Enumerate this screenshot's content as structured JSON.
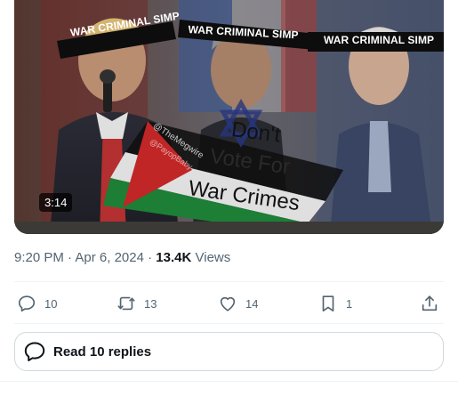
{
  "video": {
    "duration": "3:14",
    "banners": [
      "WAR CRIMINAL SIMP",
      "WAR CRIMINAL SIMP",
      "WAR CRIMINAL SIMP"
    ],
    "slogan": [
      "Don't",
      "Vote For",
      "War Crimes"
    ],
    "watermarks": [
      "@TheMegwire",
      "@PayopBaby"
    ]
  },
  "meta": {
    "time": "9:20 PM",
    "separator": "·",
    "date": "Apr 6, 2024",
    "views_count": "13.4K",
    "views_label": "Views"
  },
  "actions": {
    "replies": "10",
    "reposts": "13",
    "likes": "14",
    "bookmarks": "1"
  },
  "read_replies": {
    "label": "Read 10 replies"
  },
  "icons": {
    "reply": "reply-icon",
    "repost": "repost-icon",
    "like": "heart-icon",
    "bookmark": "bookmark-icon",
    "share": "share-icon",
    "replies_bubble": "speech-bubble-icon"
  },
  "colors": {
    "muted_text": "#536471",
    "primary_text": "#0f1419",
    "border": "#cfd9de"
  }
}
